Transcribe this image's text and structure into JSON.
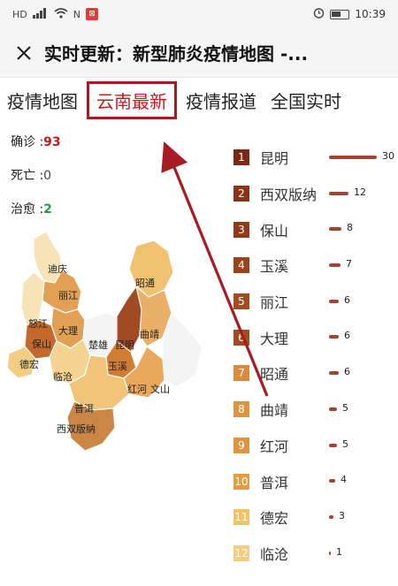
{
  "status_bar": {
    "left_icons": [
      "HD",
      "4G",
      "wifi",
      "N",
      "app"
    ],
    "time": "10:39"
  },
  "title_bar": {
    "close_icon": "close-icon",
    "title": "实时更新：新型肺炎疫情地图 -..."
  },
  "tabs": [
    {
      "label": "疫情地图",
      "active": false
    },
    {
      "label": "云南最新",
      "active": true
    },
    {
      "label": "疫情报道",
      "active": false
    },
    {
      "label": "全国实时",
      "active": false
    }
  ],
  "stats": {
    "confirmed_label": "确诊 :",
    "confirmed_value": "93",
    "death_label": "死亡 :",
    "death_value": "0",
    "cured_label": "治愈 :",
    "cured_value": "2"
  },
  "map": {
    "labels": [
      "迪庆",
      "丽江",
      "怒江",
      "昭通",
      "大理",
      "曲靖",
      "保山",
      "楚雄",
      "昆明",
      "德宏",
      "玉溪",
      "临沧",
      "红河",
      "文山",
      "普洱",
      "西双版纳"
    ]
  },
  "ranking": [
    {
      "rank": "1",
      "name": "昆明",
      "value": 30,
      "value_text": "30",
      "color": "#7a2a14"
    },
    {
      "rank": "2",
      "name": "西双版纳",
      "value": 12,
      "value_text": "12",
      "color": "#883417"
    },
    {
      "rank": "3",
      "name": "保山",
      "value": 8,
      "value_text": "8",
      "color": "#8f3b1a"
    },
    {
      "rank": "4",
      "name": "玉溪",
      "value": 7,
      "value_text": "7",
      "color": "#9a441e"
    },
    {
      "rank": "5",
      "name": "丽江",
      "value": 6,
      "value_text": "6",
      "color": "#a24c22"
    },
    {
      "rank": "6",
      "name": "大理",
      "value": 6,
      "value_text": "6",
      "color": "#a24c22"
    },
    {
      "rank": "7",
      "name": "昭通",
      "value": 6,
      "value_text": "6",
      "color": "#d98a3a"
    },
    {
      "rank": "8",
      "name": "曲靖",
      "value": 5,
      "value_text": "5",
      "color": "#df943f"
    },
    {
      "rank": "9",
      "name": "红河",
      "value": 5,
      "value_text": "5",
      "color": "#df943f"
    },
    {
      "rank": "10",
      "name": "普洱",
      "value": 4,
      "value_text": "4",
      "color": "#e19c44"
    },
    {
      "rank": "11",
      "name": "德宏",
      "value": 3,
      "value_text": "3",
      "color": "#f0c36a"
    },
    {
      "rank": "12",
      "name": "临沧",
      "value": 1,
      "value_text": "1",
      "color": "#f2cd82"
    }
  ],
  "colors": {
    "accent_red": "#c8181e",
    "annotation_red": "#a81b22",
    "bar": "#a14530"
  }
}
